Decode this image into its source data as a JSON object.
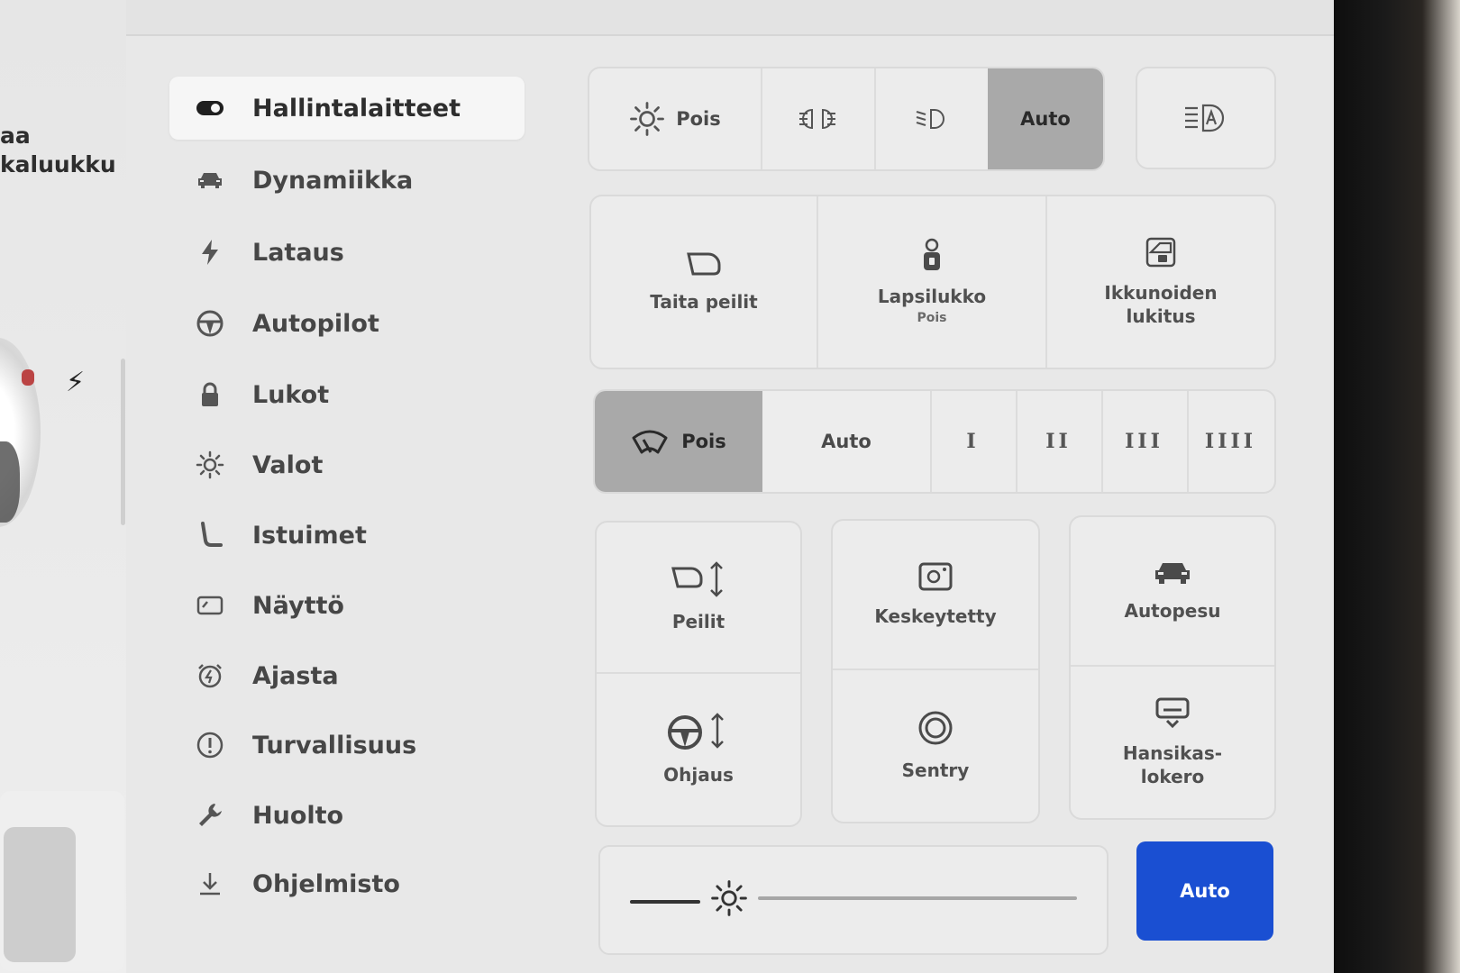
{
  "left_strip": {
    "text1": "aa",
    "text2": "kaluukku"
  },
  "sidebar": {
    "items": [
      {
        "label": "Hallintalaitteet",
        "icon": "toggle-icon",
        "active": true
      },
      {
        "label": "Dynamiikka",
        "icon": "car-icon"
      },
      {
        "label": "Lataus",
        "icon": "bolt-icon"
      },
      {
        "label": "Autopilot",
        "icon": "steering-wheel-icon"
      },
      {
        "label": "Lukot",
        "icon": "lock-icon"
      },
      {
        "label": "Valot",
        "icon": "sun-icon"
      },
      {
        "label": "Istuimet",
        "icon": "seat-icon"
      },
      {
        "label": "Näyttö",
        "icon": "display-icon"
      },
      {
        "label": "Ajasta",
        "icon": "alarm-clock-icon"
      },
      {
        "label": "Turvallisuus",
        "icon": "alert-circle-icon"
      },
      {
        "label": "Huolto",
        "icon": "wrench-icon"
      },
      {
        "label": "Ohjelmisto",
        "icon": "download-icon"
      }
    ]
  },
  "lights": {
    "off_label": "Pois",
    "auto_label": "Auto",
    "selected": "Auto",
    "auto_high_beam_icon": "auto-high-beam-icon"
  },
  "quick": {
    "fold_mirrors": "Taita peilit",
    "child_lock": "Lapsilukko",
    "child_lock_state": "Pois",
    "window_lock_line1": "Ikkunoiden",
    "window_lock_line2": "lukitus"
  },
  "wipers": {
    "off_label": "Pois",
    "auto_label": "Auto",
    "speed1": "I",
    "speed2": "II",
    "speed3": "III",
    "speed4": "IIII",
    "selected": "Pois"
  },
  "tiles": {
    "mirrors": "Peilit",
    "dashcam": "Keskeytetty",
    "carwash": "Autopesu",
    "steering": "Ohjaus",
    "sentry": "Sentry",
    "glovebox_line1": "Hansikas-",
    "glovebox_line2": "lokero"
  },
  "brightness": {
    "auto_label": "Auto",
    "level": 0.15
  },
  "colors": {
    "accent": "#1a4fd2",
    "selected_segment": "#a9a9a9"
  }
}
